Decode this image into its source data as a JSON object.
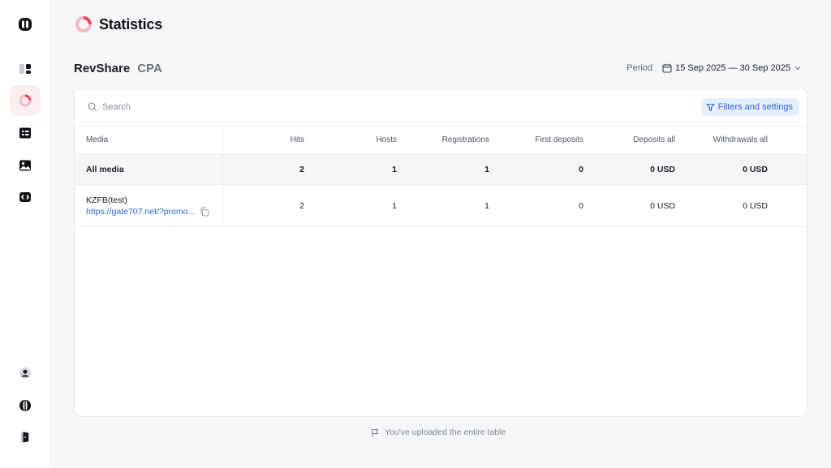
{
  "page": {
    "title": "Statistics"
  },
  "tabs": [
    {
      "label": "RevShare",
      "active": true
    },
    {
      "label": "CPA",
      "active": false
    }
  ],
  "period": {
    "label": "Period",
    "value": "15 Sep 2025 — 30 Sep 2025"
  },
  "search": {
    "placeholder": "Search"
  },
  "filters": {
    "label": "Filters and settings"
  },
  "table": {
    "columns": [
      "Media",
      "Hits",
      "Hosts",
      "Registrations",
      "First deposits",
      "Deposits all",
      "Withdrawals all"
    ],
    "total": {
      "media": "All media",
      "hits": "2",
      "hosts": "1",
      "registrations": "1",
      "first_deposits": "0",
      "deposits_all": "0 USD",
      "withdrawals_all": "0 USD"
    },
    "rows": [
      {
        "media": "KZFB(test)",
        "link": "https://gate707.net/?promo...",
        "hits": "2",
        "hosts": "1",
        "registrations": "1",
        "first_deposits": "0",
        "deposits_all": "0 USD",
        "withdrawals_all": "0 USD"
      }
    ]
  },
  "footer": {
    "note": "You've uploaded the entire table"
  },
  "colors": {
    "accent": "#2c63e0",
    "brand": "#ec4660",
    "active_bg": "#fdeef0"
  },
  "sidebar": {
    "items": [
      {
        "icon": "logo-icon"
      },
      {
        "icon": "dashboard-icon"
      },
      {
        "icon": "statistics-icon",
        "active": true
      },
      {
        "icon": "list-icon"
      },
      {
        "icon": "image-icon"
      },
      {
        "icon": "code-icon"
      },
      {
        "icon": "user-icon"
      },
      {
        "icon": "globe-icon"
      },
      {
        "icon": "logout-icon"
      }
    ]
  }
}
